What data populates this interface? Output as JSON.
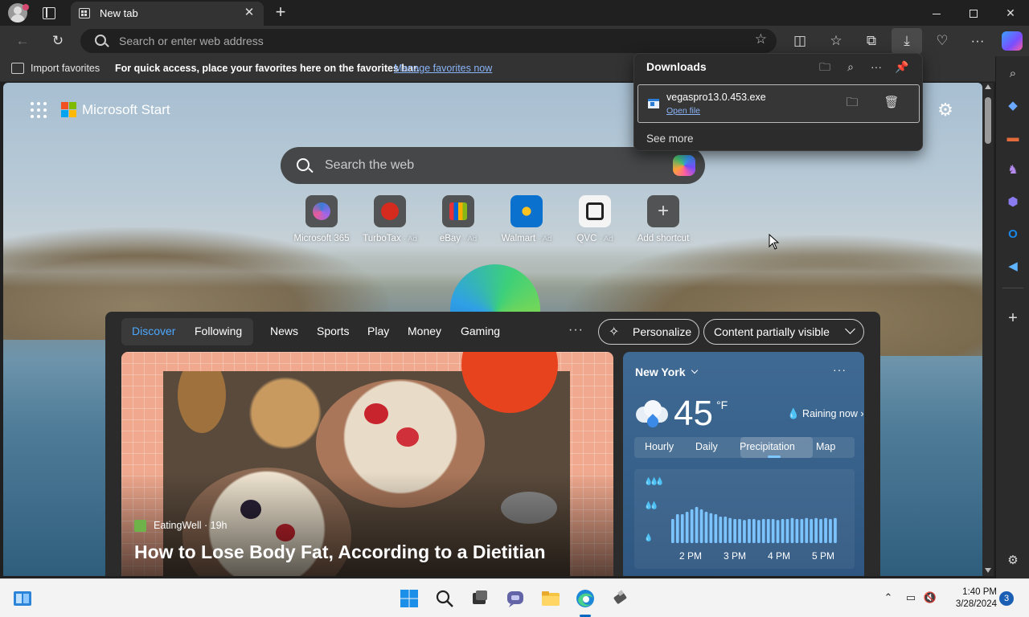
{
  "browser": {
    "tab_title": "New tab",
    "address_placeholder": "Search or enter web address"
  },
  "favorites_bar": {
    "import_label": "Import favorites",
    "message": "For quick access, place your favorites here on the favorites bar.",
    "link_label": "Manage favorites now"
  },
  "newtab": {
    "brand": "Microsoft Start",
    "search_placeholder": "Search the web",
    "shortcuts": [
      {
        "name": "Microsoft 365",
        "ad": ""
      },
      {
        "name": "TurboTax",
        "ad": "· Ad"
      },
      {
        "name": "eBay",
        "ad": "· Ad"
      },
      {
        "name": "Walmart",
        "ad": "· Ad"
      },
      {
        "name": "QVC",
        "ad": "· Ad"
      },
      {
        "name": "Add shortcut",
        "ad": ""
      }
    ]
  },
  "feed": {
    "tabs": [
      "Discover",
      "Following"
    ],
    "nav": [
      "News",
      "Sports",
      "Play",
      "Money",
      "Gaming"
    ],
    "more": "···",
    "personalize_label": "Personalize",
    "visibility_label": "Content partially visible",
    "article": {
      "source": "EatingWell · 19h",
      "title": "How to Lose Body Fat, According to a Dietitian"
    }
  },
  "weather": {
    "city": "New York",
    "more": "···",
    "temperature": "45",
    "unit": "°F",
    "condition": "Raining now",
    "tabs": [
      "Hourly",
      "Daily",
      "Precipitation",
      "Map"
    ],
    "active_tab": "Precipitation",
    "chart_times": [
      "2 PM",
      "3 PM",
      "4 PM",
      "5 PM"
    ],
    "precip_levels": [
      0.5,
      0.6,
      0.6,
      0.65,
      0.7,
      0.75,
      0.7,
      0.65,
      0.62,
      0.6,
      0.55,
      0.55,
      0.52,
      0.5,
      0.5,
      0.48,
      0.5,
      0.5,
      0.48,
      0.5,
      0.5,
      0.5,
      0.48,
      0.5,
      0.5,
      0.52,
      0.5,
      0.5,
      0.52,
      0.5,
      0.52,
      0.5,
      0.52,
      0.5,
      0.52
    ]
  },
  "downloads": {
    "title": "Downloads",
    "file_name": "vegaspro13.0.453.exe",
    "open_label": "Open file",
    "see_more": "See more"
  },
  "taskbar": {
    "time": "1:40 PM",
    "date": "3/28/2024",
    "notification_count": "3"
  }
}
